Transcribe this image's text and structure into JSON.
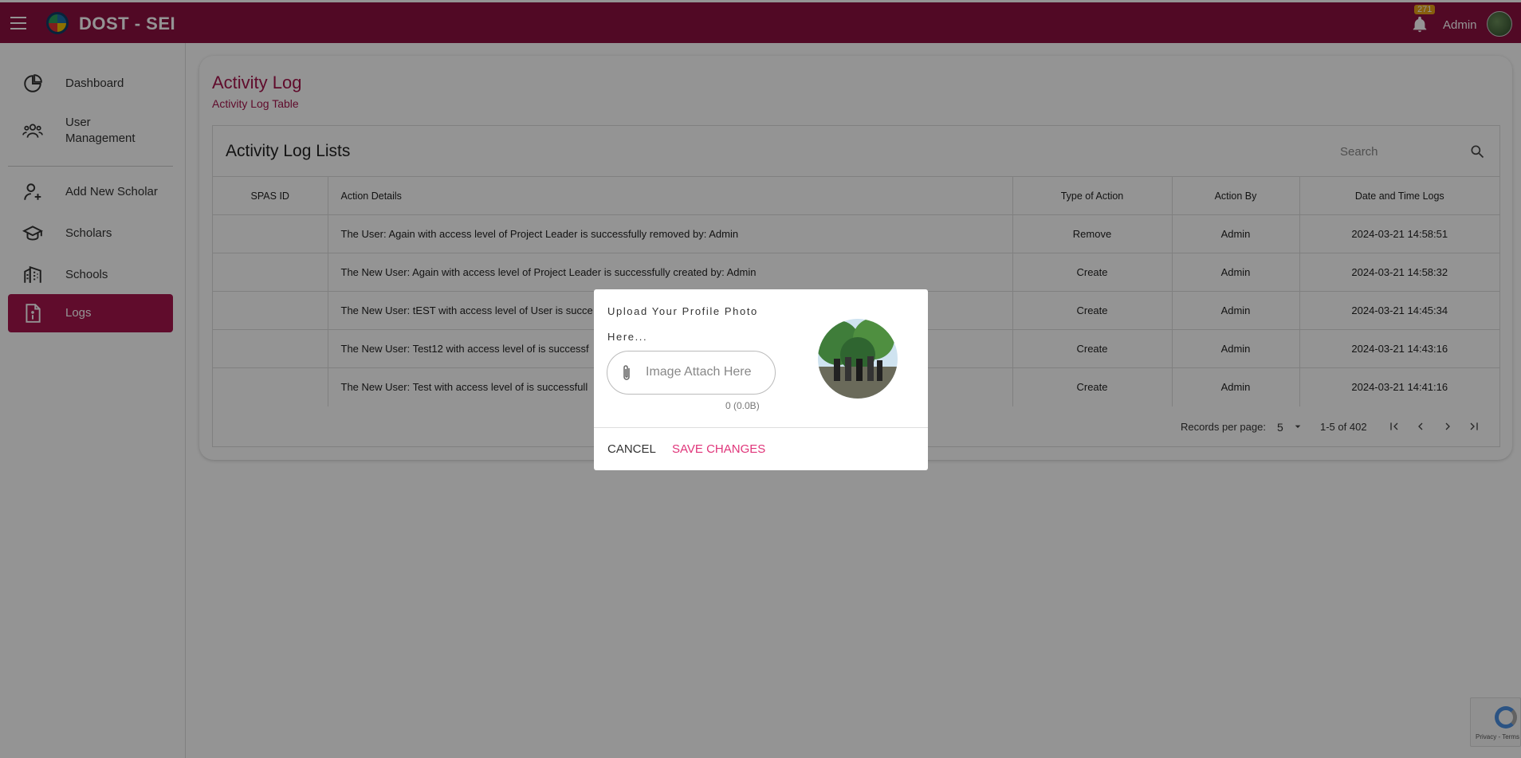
{
  "header": {
    "app_name": "DOST - SEI",
    "notification_count": "271",
    "user_name": "Admin"
  },
  "sidebar": {
    "items": [
      {
        "label": "Dashboard",
        "icon": "pie-chart-icon"
      },
      {
        "label": "User Management",
        "icon": "users-icon"
      },
      {
        "label": "Add New Scholar",
        "icon": "person-add-icon"
      },
      {
        "label": "Scholars",
        "icon": "graduation-cap-icon"
      },
      {
        "label": "Schools",
        "icon": "building-icon"
      },
      {
        "label": "Logs",
        "icon": "document-info-icon"
      }
    ],
    "user_management_line1": "User",
    "user_management_line2": "Management"
  },
  "page": {
    "title": "Activity Log",
    "subtitle": "Activity Log Table"
  },
  "table": {
    "title": "Activity Log Lists",
    "search_placeholder": "Search",
    "columns": [
      "SPAS ID",
      "Action Details",
      "Type of Action",
      "Action By",
      "Date and Time Logs"
    ],
    "rows": [
      {
        "spas_id": "",
        "details": "The User: Again with access level of Project Leader is successfully removed by: Admin",
        "type": "Remove",
        "by": "Admin",
        "datetime": "2024-03-21 14:58:51"
      },
      {
        "spas_id": "",
        "details": "The New User: Again with access level of Project Leader is successfully created by: Admin",
        "type": "Create",
        "by": "Admin",
        "datetime": "2024-03-21 14:58:32"
      },
      {
        "spas_id": "",
        "details": "The New User: tEST with access level of User is succe",
        "type": "Create",
        "by": "Admin",
        "datetime": "2024-03-21 14:45:34"
      },
      {
        "spas_id": "",
        "details": "The New User: Test12 with access level of is successf",
        "type": "Create",
        "by": "Admin",
        "datetime": "2024-03-21 14:43:16"
      },
      {
        "spas_id": "",
        "details": "The New User: Test with access level of is successfull",
        "type": "Create",
        "by": "Admin",
        "datetime": "2024-03-21 14:41:16"
      }
    ],
    "pagination": {
      "records_label": "Records per page:",
      "per_page": "5",
      "range": "1-5 of 402"
    }
  },
  "modal": {
    "title": "Upload Your Profile Photo Here...",
    "attach_placeholder": "Image Attach Here",
    "file_count": "0 (0.0B)",
    "cancel_label": "CANCEL",
    "save_label": "SAVE CHANGES"
  },
  "recaptcha": {
    "text": "Privacy - Terms"
  },
  "colors": {
    "brand": "#8c1140",
    "accent": "#a5154d",
    "save": "#e0357a"
  }
}
